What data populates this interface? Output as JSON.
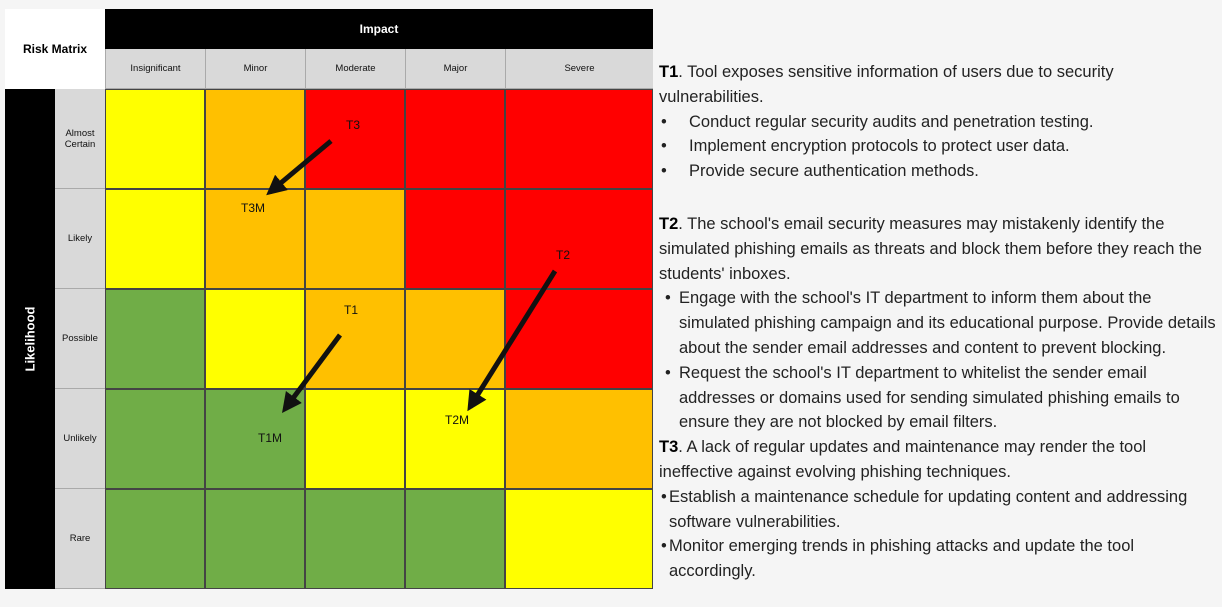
{
  "matrix": {
    "title": "Risk Matrix",
    "impact_label": "Impact",
    "likelihood_label": "Likelihood",
    "impact_levels": [
      "Insignificant",
      "Minor",
      "Moderate",
      "Major",
      "Severe"
    ],
    "likelihood_levels": [
      "Almost Certain",
      "Likely",
      "Possible",
      "Unlikely",
      "Rare"
    ],
    "colors": {
      "green": "#70ad47",
      "yellow": "#ffff00",
      "amber": "#ffc000",
      "red": "#ff0000"
    },
    "cells": [
      [
        "yellow",
        "amber",
        "red",
        "red",
        "red"
      ],
      [
        "yellow",
        "amber",
        "amber",
        "red",
        "red"
      ],
      [
        "green",
        "yellow",
        "amber",
        "amber",
        "red"
      ],
      [
        "green",
        "green",
        "yellow",
        "yellow",
        "amber"
      ],
      [
        "green",
        "green",
        "green",
        "green",
        "yellow"
      ]
    ],
    "threat_markers": [
      {
        "label": "T3",
        "likelihood": "Almost Certain",
        "impact": "Moderate"
      },
      {
        "label": "T3M",
        "likelihood": "Likely",
        "impact": "Minor"
      },
      {
        "label": "T2",
        "likelihood": "Likely",
        "impact": "Severe"
      },
      {
        "label": "T2M",
        "likelihood": "Unlikely",
        "impact": "Major"
      },
      {
        "label": "T1",
        "likelihood": "Possible",
        "impact": "Moderate"
      },
      {
        "label": "T1M",
        "likelihood": "Unlikely",
        "impact": "Minor"
      }
    ]
  },
  "threats": [
    {
      "id": "T1",
      "description": ".  Tool exposes sensitive information of users due to security vulnerabilities.",
      "mitigations": [
        "Conduct regular security audits and penetration testing.",
        "Implement encryption protocols to protect user data.",
        "Provide secure authentication methods."
      ]
    },
    {
      "id": "T2",
      "description": ". The school's email security measures may mistakenly identify the simulated phishing emails as threats and block them before they reach the students' inboxes.",
      "mitigations": [
        "Engage with the school's IT department to inform them about the simulated phishing campaign and its educational purpose. Provide details about the sender email addresses and content to prevent blocking.",
        "Request the school's IT department to whitelist the sender email addresses or domains used for sending simulated phishing emails to ensure they are not blocked by email filters."
      ]
    },
    {
      "id": "T3",
      "description": ". A lack of regular updates and maintenance may render the tool ineffective against evolving phishing techniques.",
      "mitigations": [
        "Establish a maintenance schedule for updating content and addressing software vulnerabilities.",
        "Monitor emerging trends in phishing attacks and update the tool accordingly."
      ]
    }
  ]
}
